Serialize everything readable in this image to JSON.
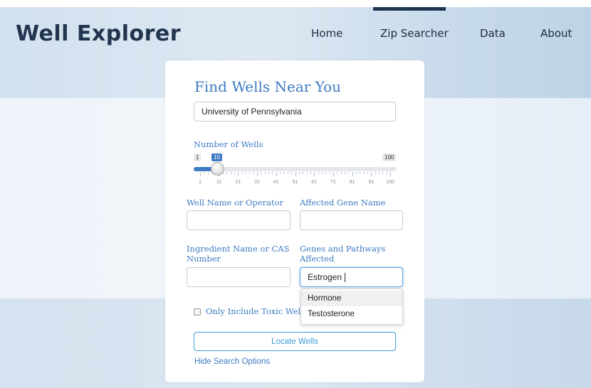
{
  "brand": "Well Explorer",
  "nav": {
    "home": "Home",
    "zip_searcher": "Zip Searcher",
    "data": "Data",
    "about": "About",
    "active": "Zip Searcher"
  },
  "form": {
    "title": "Find Wells Near You",
    "location_value": "University of Pennsylvania",
    "slider": {
      "label": "Number of Wells",
      "min": "1",
      "max": "100",
      "value": "10",
      "ticks": [
        "1",
        "11",
        "21",
        "31",
        "41",
        "51",
        "61",
        "71",
        "81",
        "91",
        "100"
      ]
    },
    "well_name_label": "Well Name or Operator",
    "well_name_value": "",
    "gene_name_label": "Affected Gene Name",
    "gene_name_value": "",
    "ingredient_label_line1": "Ingredient Name or CAS",
    "ingredient_label_line2": "Number",
    "ingredient_value": "",
    "pathways_label_line1": "Genes and Pathways",
    "pathways_label_line2": "Affected",
    "pathways_value": "Estrogen",
    "dropdown_options": [
      "Hormone",
      "Testosterone"
    ],
    "toxic_checkbox_label": "Only Include Toxic Wells",
    "toxic_checked": false,
    "locate_button": "Locate Wells",
    "hide_link": "Hide Search Options"
  },
  "colors": {
    "brand": "#22354f",
    "accent": "#3d7bc2",
    "button": "#3d9ed6"
  }
}
